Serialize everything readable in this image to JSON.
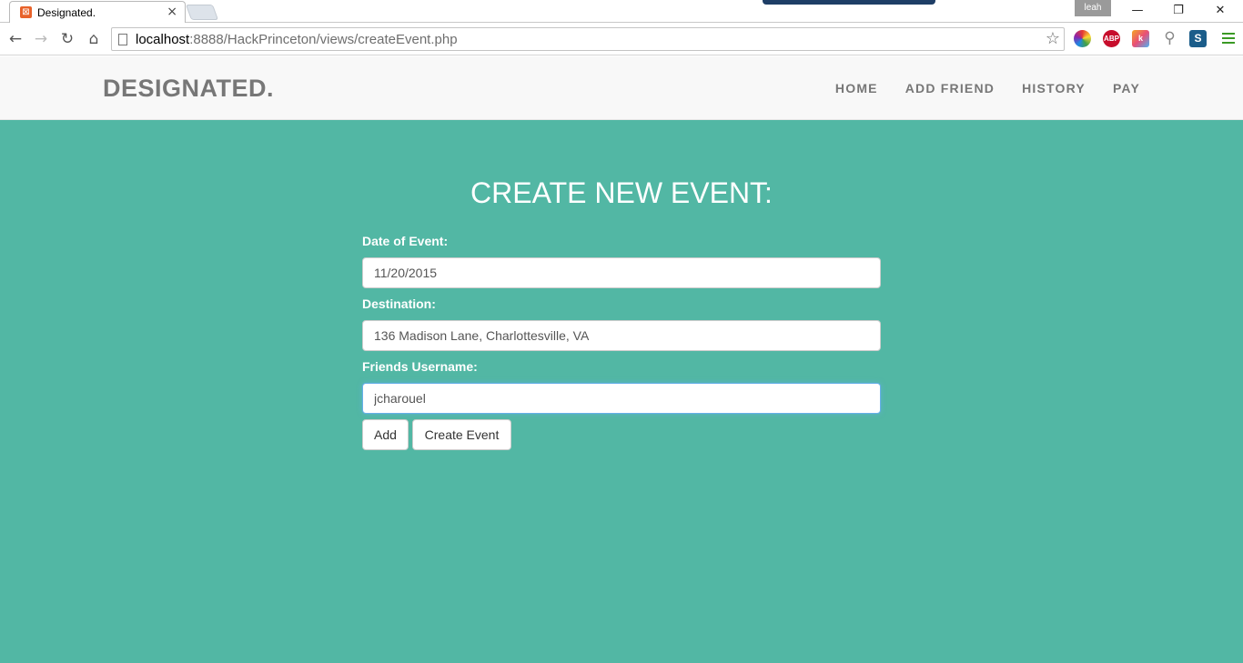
{
  "browser": {
    "tab_title": "Designated.",
    "tab_close": "×",
    "profile_name": "leah",
    "url_host": "localhost",
    "url_rest": ":8888/HackPrinceton/views/createEvent.php",
    "icons": {
      "back": "back-arrow-icon",
      "forward": "forward-arrow-icon",
      "reload": "reload-icon",
      "home": "home-icon",
      "bookmark": "star-icon",
      "menu": "hamburger-menu-icon"
    },
    "extensions": {
      "abp": "ABP",
      "k": "k",
      "s": "S"
    },
    "window_controls": {
      "minimize": "—",
      "restore": "❐",
      "close": "✕"
    }
  },
  "navbar": {
    "brand": "DESIGNATED.",
    "links": [
      "HOME",
      "ADD FRIEND",
      "HISTORY",
      "PAY"
    ]
  },
  "form": {
    "heading": "CREATE NEW EVENT:",
    "date_label": "Date of Event:",
    "date_value": "11/20/2015",
    "destination_label": "Destination:",
    "destination_value": "136 Madison Lane, Charlottesville, VA",
    "friends_label": "Friends Username:",
    "friends_value": "jcharouel",
    "add_button": "Add",
    "create_button": "Create Event"
  },
  "colors": {
    "main_background": "#52b7a4",
    "navbar_background": "#f8f8f8",
    "nav_text": "#777777"
  }
}
